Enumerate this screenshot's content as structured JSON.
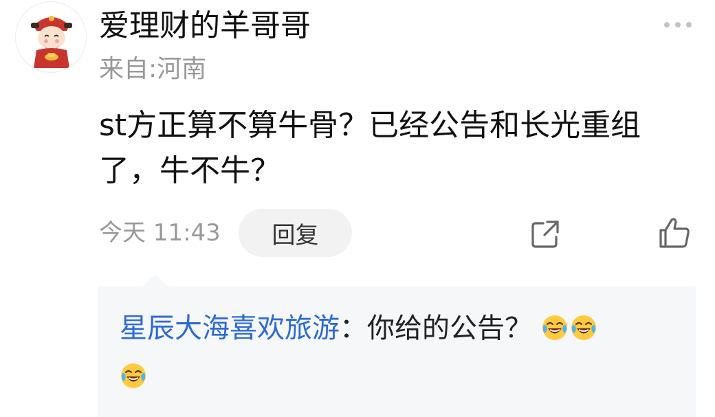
{
  "comment": {
    "username": "爱理财的羊哥哥",
    "location": "来自:河南",
    "text": "st方正算不算牛骨？已经公告和长光重组了，牛不牛？",
    "time": "今天 11:43",
    "reply_label": "回复",
    "icons": {
      "more": "more-dots-icon",
      "share": "share-icon",
      "like": "thumbs-up-icon",
      "avatar": "caishen-avatar"
    }
  },
  "reply": {
    "author": "星辰大海喜欢旅游",
    "separator": "：",
    "text": "你给的公告？",
    "emoji_name": "laughing-crying-emoji",
    "emoji_count": 3
  },
  "colors": {
    "author_link": "#2c6bd4",
    "muted_text": "#999999",
    "reply_bg": "#f6f7f8",
    "button_bg": "#f2f2f2"
  }
}
